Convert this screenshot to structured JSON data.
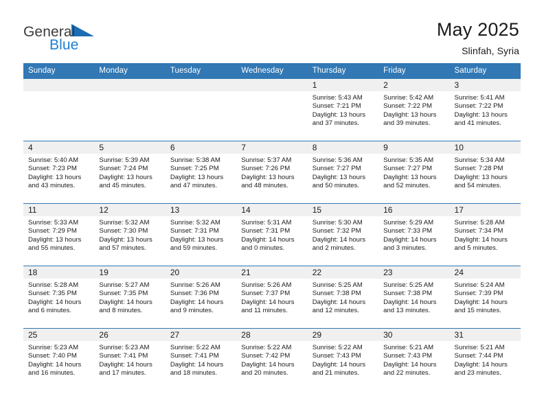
{
  "brand": {
    "line1": "General",
    "line2": "Blue",
    "accent_color": "#1a7fd4",
    "triangle_icon": "brand-triangle-icon"
  },
  "header": {
    "title": "May 2025",
    "subtitle": "Slinfah, Syria",
    "header_bg_color": "#3178b4"
  },
  "weekday_headers": [
    "Sunday",
    "Monday",
    "Tuesday",
    "Wednesday",
    "Thursday",
    "Friday",
    "Saturday"
  ],
  "weeks": [
    [
      {
        "day": "",
        "empty": true
      },
      {
        "day": "",
        "empty": true
      },
      {
        "day": "",
        "empty": true
      },
      {
        "day": "",
        "empty": true
      },
      {
        "day": "1",
        "sunrise": "Sunrise: 5:43 AM",
        "sunset": "Sunset: 7:21 PM",
        "daylight1": "Daylight: 13 hours",
        "daylight2": "and 37 minutes."
      },
      {
        "day": "2",
        "sunrise": "Sunrise: 5:42 AM",
        "sunset": "Sunset: 7:22 PM",
        "daylight1": "Daylight: 13 hours",
        "daylight2": "and 39 minutes."
      },
      {
        "day": "3",
        "sunrise": "Sunrise: 5:41 AM",
        "sunset": "Sunset: 7:22 PM",
        "daylight1": "Daylight: 13 hours",
        "daylight2": "and 41 minutes."
      }
    ],
    [
      {
        "day": "4",
        "sunrise": "Sunrise: 5:40 AM",
        "sunset": "Sunset: 7:23 PM",
        "daylight1": "Daylight: 13 hours",
        "daylight2": "and 43 minutes."
      },
      {
        "day": "5",
        "sunrise": "Sunrise: 5:39 AM",
        "sunset": "Sunset: 7:24 PM",
        "daylight1": "Daylight: 13 hours",
        "daylight2": "and 45 minutes."
      },
      {
        "day": "6",
        "sunrise": "Sunrise: 5:38 AM",
        "sunset": "Sunset: 7:25 PM",
        "daylight1": "Daylight: 13 hours",
        "daylight2": "and 47 minutes."
      },
      {
        "day": "7",
        "sunrise": "Sunrise: 5:37 AM",
        "sunset": "Sunset: 7:26 PM",
        "daylight1": "Daylight: 13 hours",
        "daylight2": "and 48 minutes."
      },
      {
        "day": "8",
        "sunrise": "Sunrise: 5:36 AM",
        "sunset": "Sunset: 7:27 PM",
        "daylight1": "Daylight: 13 hours",
        "daylight2": "and 50 minutes."
      },
      {
        "day": "9",
        "sunrise": "Sunrise: 5:35 AM",
        "sunset": "Sunset: 7:27 PM",
        "daylight1": "Daylight: 13 hours",
        "daylight2": "and 52 minutes."
      },
      {
        "day": "10",
        "sunrise": "Sunrise: 5:34 AM",
        "sunset": "Sunset: 7:28 PM",
        "daylight1": "Daylight: 13 hours",
        "daylight2": "and 54 minutes."
      }
    ],
    [
      {
        "day": "11",
        "sunrise": "Sunrise: 5:33 AM",
        "sunset": "Sunset: 7:29 PM",
        "daylight1": "Daylight: 13 hours",
        "daylight2": "and 55 minutes."
      },
      {
        "day": "12",
        "sunrise": "Sunrise: 5:32 AM",
        "sunset": "Sunset: 7:30 PM",
        "daylight1": "Daylight: 13 hours",
        "daylight2": "and 57 minutes."
      },
      {
        "day": "13",
        "sunrise": "Sunrise: 5:32 AM",
        "sunset": "Sunset: 7:31 PM",
        "daylight1": "Daylight: 13 hours",
        "daylight2": "and 59 minutes."
      },
      {
        "day": "14",
        "sunrise": "Sunrise: 5:31 AM",
        "sunset": "Sunset: 7:31 PM",
        "daylight1": "Daylight: 14 hours",
        "daylight2": "and 0 minutes."
      },
      {
        "day": "15",
        "sunrise": "Sunrise: 5:30 AM",
        "sunset": "Sunset: 7:32 PM",
        "daylight1": "Daylight: 14 hours",
        "daylight2": "and 2 minutes."
      },
      {
        "day": "16",
        "sunrise": "Sunrise: 5:29 AM",
        "sunset": "Sunset: 7:33 PM",
        "daylight1": "Daylight: 14 hours",
        "daylight2": "and 3 minutes."
      },
      {
        "day": "17",
        "sunrise": "Sunrise: 5:28 AM",
        "sunset": "Sunset: 7:34 PM",
        "daylight1": "Daylight: 14 hours",
        "daylight2": "and 5 minutes."
      }
    ],
    [
      {
        "day": "18",
        "sunrise": "Sunrise: 5:28 AM",
        "sunset": "Sunset: 7:35 PM",
        "daylight1": "Daylight: 14 hours",
        "daylight2": "and 6 minutes."
      },
      {
        "day": "19",
        "sunrise": "Sunrise: 5:27 AM",
        "sunset": "Sunset: 7:35 PM",
        "daylight1": "Daylight: 14 hours",
        "daylight2": "and 8 minutes."
      },
      {
        "day": "20",
        "sunrise": "Sunrise: 5:26 AM",
        "sunset": "Sunset: 7:36 PM",
        "daylight1": "Daylight: 14 hours",
        "daylight2": "and 9 minutes."
      },
      {
        "day": "21",
        "sunrise": "Sunrise: 5:26 AM",
        "sunset": "Sunset: 7:37 PM",
        "daylight1": "Daylight: 14 hours",
        "daylight2": "and 11 minutes."
      },
      {
        "day": "22",
        "sunrise": "Sunrise: 5:25 AM",
        "sunset": "Sunset: 7:38 PM",
        "daylight1": "Daylight: 14 hours",
        "daylight2": "and 12 minutes."
      },
      {
        "day": "23",
        "sunrise": "Sunrise: 5:25 AM",
        "sunset": "Sunset: 7:38 PM",
        "daylight1": "Daylight: 14 hours",
        "daylight2": "and 13 minutes."
      },
      {
        "day": "24",
        "sunrise": "Sunrise: 5:24 AM",
        "sunset": "Sunset: 7:39 PM",
        "daylight1": "Daylight: 14 hours",
        "daylight2": "and 15 minutes."
      }
    ],
    [
      {
        "day": "25",
        "sunrise": "Sunrise: 5:23 AM",
        "sunset": "Sunset: 7:40 PM",
        "daylight1": "Daylight: 14 hours",
        "daylight2": "and 16 minutes."
      },
      {
        "day": "26",
        "sunrise": "Sunrise: 5:23 AM",
        "sunset": "Sunset: 7:41 PM",
        "daylight1": "Daylight: 14 hours",
        "daylight2": "and 17 minutes."
      },
      {
        "day": "27",
        "sunrise": "Sunrise: 5:22 AM",
        "sunset": "Sunset: 7:41 PM",
        "daylight1": "Daylight: 14 hours",
        "daylight2": "and 18 minutes."
      },
      {
        "day": "28",
        "sunrise": "Sunrise: 5:22 AM",
        "sunset": "Sunset: 7:42 PM",
        "daylight1": "Daylight: 14 hours",
        "daylight2": "and 20 minutes."
      },
      {
        "day": "29",
        "sunrise": "Sunrise: 5:22 AM",
        "sunset": "Sunset: 7:43 PM",
        "daylight1": "Daylight: 14 hours",
        "daylight2": "and 21 minutes."
      },
      {
        "day": "30",
        "sunrise": "Sunrise: 5:21 AM",
        "sunset": "Sunset: 7:43 PM",
        "daylight1": "Daylight: 14 hours",
        "daylight2": "and 22 minutes."
      },
      {
        "day": "31",
        "sunrise": "Sunrise: 5:21 AM",
        "sunset": "Sunset: 7:44 PM",
        "daylight1": "Daylight: 14 hours",
        "daylight2": "and 23 minutes."
      }
    ]
  ]
}
